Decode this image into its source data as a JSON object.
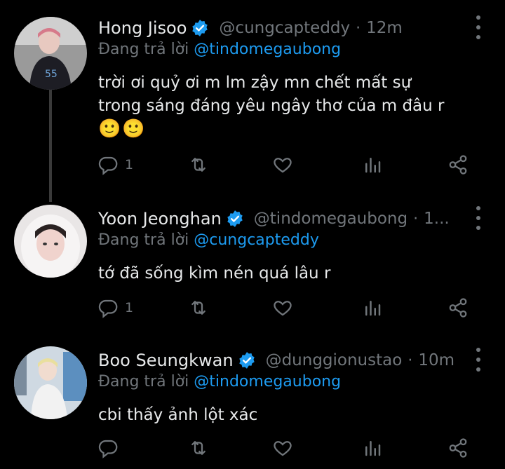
{
  "tweets": [
    {
      "name": "Hong Jisoo",
      "handle": "@cungcapteddy",
      "time": "12m",
      "reply_label": "Đang trả lời",
      "reply_to": "@tindomegaubong",
      "text_lines": [
        "trời ơi quỷ ơi m lm zậy mn chết mất sự",
        "trong sáng đáng yêu ngây thơ của m đâu r"
      ],
      "emoji": "🙂🙂",
      "reply_count": "1"
    },
    {
      "name": "Yoon Jeonghan",
      "handle": "@tindomegaubong",
      "time": "1...",
      "reply_label": "Đang trả lời",
      "reply_to": "@cungcapteddy",
      "text_lines": [
        "tớ đã sống kìm nén quá lâu r"
      ],
      "reply_count": "1"
    },
    {
      "name": "Boo Seungkwan",
      "handle": "@dunggionustao",
      "time": "10m",
      "reply_label": "Đang trả lời",
      "reply_to": "@tindomegaubong",
      "text_lines": [
        "cbi thấy ảnh lột xác"
      ],
      "reply_count": ""
    }
  ],
  "colors": {
    "accent": "#1d9bf0",
    "muted": "#71767b",
    "text": "#e7e9ea",
    "background": "#000000"
  },
  "icons": [
    "reply-icon",
    "retweet-icon",
    "like-icon",
    "views-icon",
    "share-icon",
    "verified-icon",
    "more-icon"
  ]
}
